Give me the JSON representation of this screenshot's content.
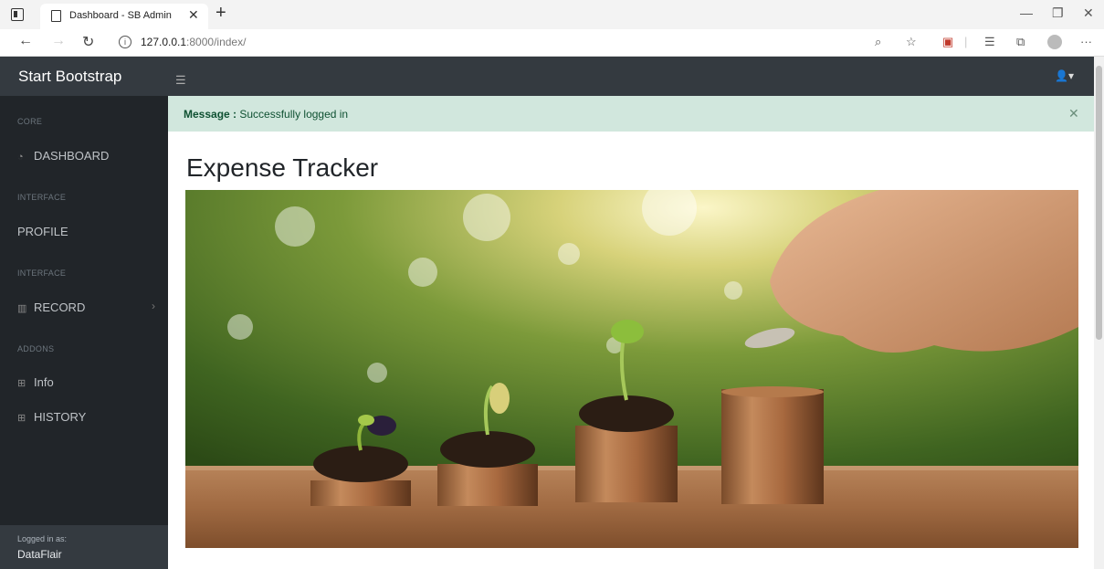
{
  "browser": {
    "tab_title": "Dashboard - SB Admin",
    "url_host": "127.0.0.1",
    "url_path": ":8000/index/"
  },
  "app": {
    "brand": "Start Bootstrap",
    "page_title": "Expense Tracker",
    "alert": {
      "label": "Message :",
      "text": "Successfully logged in"
    }
  },
  "sidebar": {
    "sections": [
      {
        "heading": "CORE"
      },
      {
        "heading": "INTERFACE"
      },
      {
        "heading": "INTERFACE"
      },
      {
        "heading": "ADDONS"
      }
    ],
    "items": [
      {
        "label": "DASHBOARD",
        "icon": "tachometer-icon"
      },
      {
        "label": "PROFILE"
      },
      {
        "label": "RECORD",
        "icon": "columns-icon"
      },
      {
        "label": "Info",
        "icon": "table-icon"
      },
      {
        "label": "HISTORY",
        "icon": "table-icon"
      }
    ],
    "footer": {
      "label": "Logged in as:",
      "user": "DataFlair"
    }
  },
  "colors": {
    "nav_bg": "#343a40",
    "sidebar_bg": "#212529",
    "alert_bg": "#d1e7dd",
    "alert_text": "#0f5132"
  }
}
